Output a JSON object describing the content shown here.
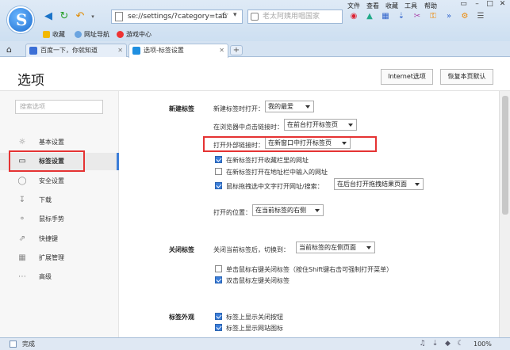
{
  "browser": {
    "logo_letter": "S",
    "address": "se://settings/?category=tab",
    "search_placeholder": "老太阿姨用唱国家",
    "menu": [
      "文件",
      "查看",
      "收藏",
      "工具",
      "帮助"
    ],
    "bookmarks": [
      "收藏",
      "网址导航",
      "游戏中心"
    ],
    "tabs": [
      {
        "label": "百度一下，你就知道",
        "active": false
      },
      {
        "label": "选项-标签设置",
        "active": true
      }
    ],
    "new_tab": "+"
  },
  "header": {
    "title": "选项",
    "buttons": [
      "Internet选项",
      "恢复本页默认"
    ]
  },
  "sidebar": {
    "search_placeholder": "搜索选项",
    "items": [
      {
        "label": "基本设置",
        "icon": "gear-icon",
        "active": false
      },
      {
        "label": "标签设置",
        "icon": "tab-icon",
        "active": true
      },
      {
        "label": "安全设置",
        "icon": "shield-icon",
        "active": false
      },
      {
        "label": "下载",
        "icon": "download-icon",
        "active": false
      },
      {
        "label": "鼠标手势",
        "icon": "mouse-gesture-icon",
        "active": false
      },
      {
        "label": "快捷键",
        "icon": "shortcut-icon",
        "active": false
      },
      {
        "label": "扩展管理",
        "icon": "extensions-icon",
        "active": false
      },
      {
        "label": "高级",
        "icon": "more-icon",
        "active": false
      }
    ]
  },
  "sections": {
    "new_tab": {
      "title": "新建标签",
      "open_new_tab_label": "新建标签时打开：",
      "open_new_tab_value": "我的最爱",
      "click_link_label": "在浏览器中点击链接时：",
      "click_link_value": "在前台打开标签页",
      "external_link_label": "打开外部链接时：",
      "external_link_value": "在新窗口中打开标签页",
      "checkboxes": [
        {
          "label": "在新标签打开收藏栏里的网址",
          "checked": true
        },
        {
          "label": "在新标签打开在地址栏中输入的网址",
          "checked": false
        },
        {
          "label": "鼠标拖拽选中文字打开网址/搜索：",
          "checked": true
        }
      ],
      "drag_value": "在后台打开拖拽结果页面",
      "position_label": "打开的位置：",
      "position_value": "在当前标签的右侧"
    },
    "close_tab": {
      "title": "关闭标签",
      "after_close_label": "关闭当前标签后，切换到：",
      "after_close_value": "当前标签的左侧页面",
      "checkboxes": [
        {
          "label": "单击鼠标右键关闭标签（按住Shift键右击可强制打开菜单）",
          "checked": false
        },
        {
          "label": "双击鼠标左键关闭标签",
          "checked": true
        }
      ]
    },
    "appearance": {
      "title": "标签外观",
      "checkboxes": [
        {
          "label": "标签上显示关闭按钮",
          "checked": true
        },
        {
          "label": "标签上显示网站图标",
          "checked": true
        }
      ]
    }
  },
  "status": {
    "text": "完成",
    "zoom": "100%"
  }
}
